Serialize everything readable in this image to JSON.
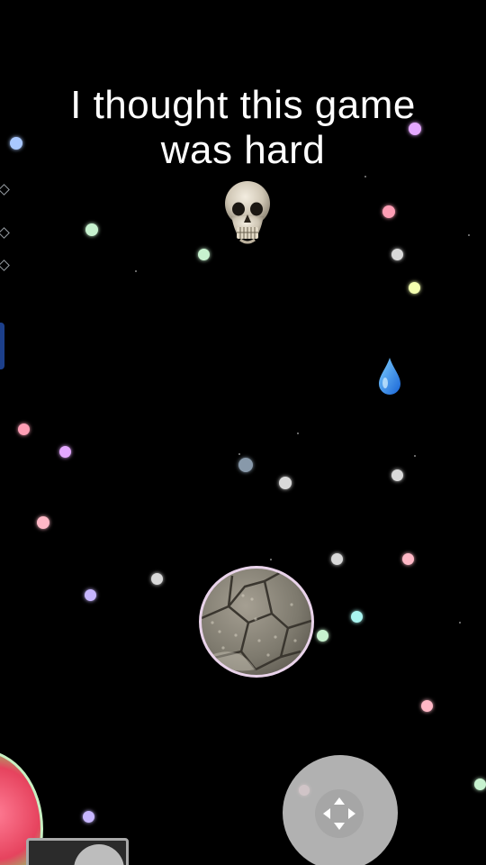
{
  "caption": {
    "line1": "I thought this game",
    "line2": "was hard"
  },
  "colors": {
    "background": "#000000",
    "player_outline": "#e9d3ea",
    "joystick": "#c9c9c9",
    "drop": "#2e8ff0"
  },
  "icons": {
    "skull": "skull-icon",
    "drop": "water-drop-icon",
    "joystick_arrows": "four-way-arrows-icon"
  },
  "pellet_colors": [
    "#a9c8ff",
    "#c7f2cf",
    "#ff9eb5",
    "#d9d9d9",
    "#f4ffb0",
    "#e4a8ff",
    "#c7b6ff",
    "#a9f5f0",
    "#ffb8c6",
    "#8899aa"
  ]
}
